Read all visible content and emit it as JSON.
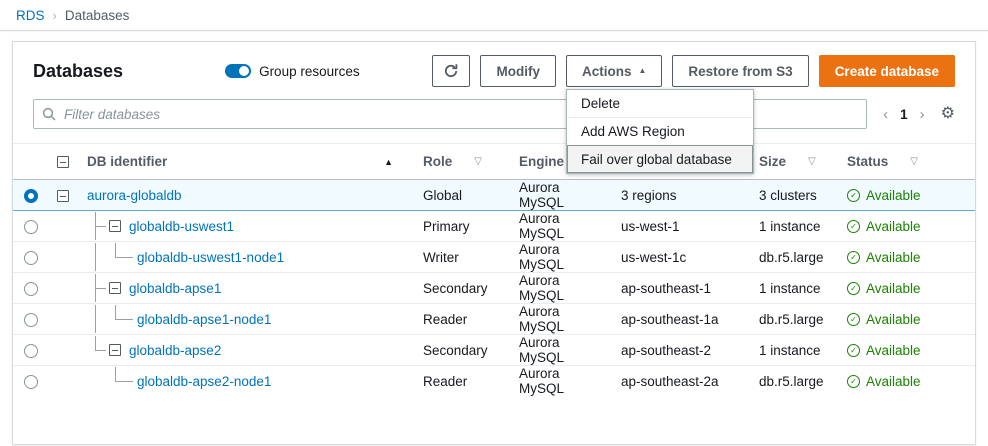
{
  "breadcrumb": {
    "items": [
      {
        "label": "RDS"
      },
      {
        "label": "Databases"
      }
    ],
    "separator": "›"
  },
  "toolbar": {
    "title": "Databases",
    "group_toggle_label": "Group resources",
    "group_toggle_on": true,
    "modify_label": "Modify",
    "actions_label": "Actions",
    "restore_label": "Restore from S3",
    "create_label": "Create database"
  },
  "actions_menu": {
    "items": [
      {
        "label": "Delete"
      },
      {
        "label": "Add AWS Region"
      },
      {
        "label": "Fail over global database"
      }
    ],
    "highlighted": "Fail over global database"
  },
  "filter": {
    "placeholder": "Filter databases"
  },
  "pagination": {
    "prev": "‹",
    "page": "1",
    "next": "›"
  },
  "icons": {
    "gear": "⚙",
    "check": "✓",
    "sort_asc": "▲",
    "sort_desc": "▽",
    "caret_up": "▲"
  },
  "table": {
    "columns": [
      {
        "label": "DB identifier",
        "sort": "asc"
      },
      {
        "label": "Role"
      },
      {
        "label": "Engine"
      },
      {
        "label": ""
      },
      {
        "label": "Size"
      },
      {
        "label": "Status"
      }
    ],
    "rows": [
      {
        "id": "aurora-globaldb",
        "role": "Global",
        "engine": "Aurora MySQL",
        "region": "3 regions",
        "size": "3 clusters",
        "status": "Available",
        "selected": true,
        "level": 0
      },
      {
        "id": "globaldb-uswest1",
        "role": "Primary",
        "engine": "Aurora MySQL",
        "region": "us-west-1",
        "size": "1 instance",
        "status": "Available",
        "selected": false,
        "level": 1
      },
      {
        "id": "globaldb-uswest1-node1",
        "role": "Writer",
        "engine": "Aurora MySQL",
        "region": "us-west-1c",
        "size": "db.r5.large",
        "status": "Available",
        "selected": false,
        "level": 2
      },
      {
        "id": "globaldb-apse1",
        "role": "Secondary",
        "engine": "Aurora MySQL",
        "region": "ap-southeast-1",
        "size": "1 instance",
        "status": "Available",
        "selected": false,
        "level": 1
      },
      {
        "id": "globaldb-apse1-node1",
        "role": "Reader",
        "engine": "Aurora MySQL",
        "region": "ap-southeast-1a",
        "size": "db.r5.large",
        "status": "Available",
        "selected": false,
        "level": 2
      },
      {
        "id": "globaldb-apse2",
        "role": "Secondary",
        "engine": "Aurora MySQL",
        "region": "ap-southeast-2",
        "size": "1 instance",
        "status": "Available",
        "selected": false,
        "level": 1
      },
      {
        "id": "globaldb-apse2-node1",
        "role": "Reader",
        "engine": "Aurora MySQL",
        "region": "ap-southeast-2a",
        "size": "db.r5.large",
        "status": "Available",
        "selected": false,
        "level": 2
      }
    ]
  },
  "colors": {
    "link_blue": "#0073bb",
    "accent_orange": "#ec7211",
    "status_green": "#1d8102",
    "selected_row_bg": "#f1faff",
    "toggle_on": "#0073bb"
  }
}
